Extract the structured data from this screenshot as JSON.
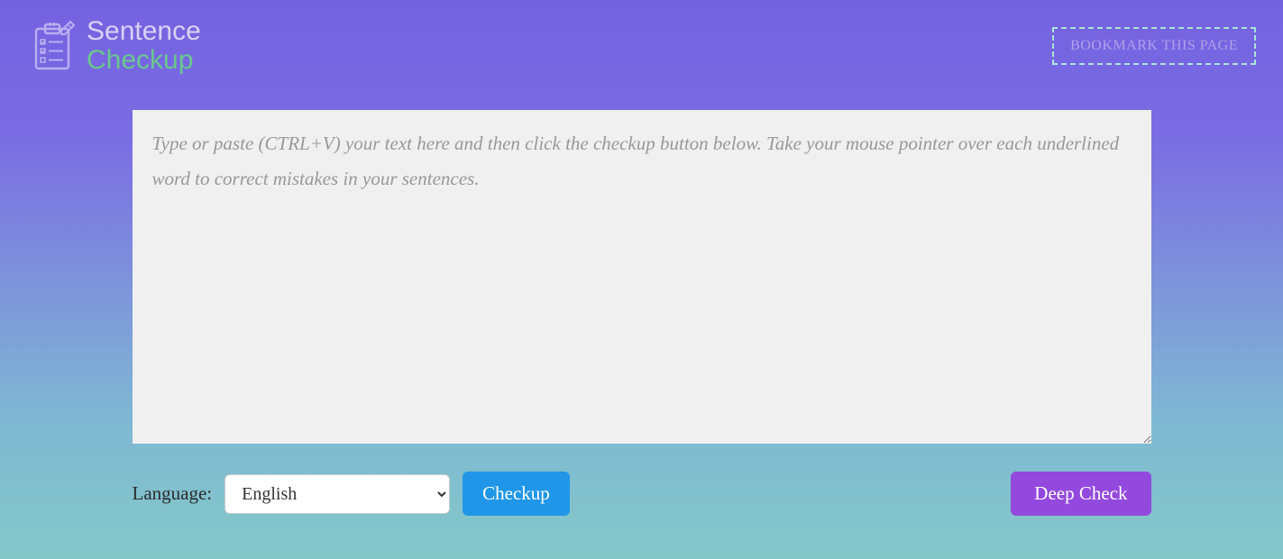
{
  "logo": {
    "line1": "Sentence",
    "line2": "Checkup"
  },
  "header": {
    "bookmark_label": "BOOKMARK THIS PAGE"
  },
  "editor": {
    "placeholder": "Type or paste (CTRL+V) your text here and then click the checkup button below. Take your mouse pointer over each underlined word to correct mistakes in your sentences.",
    "value": ""
  },
  "controls": {
    "language_label": "Language:",
    "language_options": [
      "English"
    ],
    "language_selected": "English",
    "checkup_label": "Checkup",
    "deep_check_label": "Deep Check"
  }
}
